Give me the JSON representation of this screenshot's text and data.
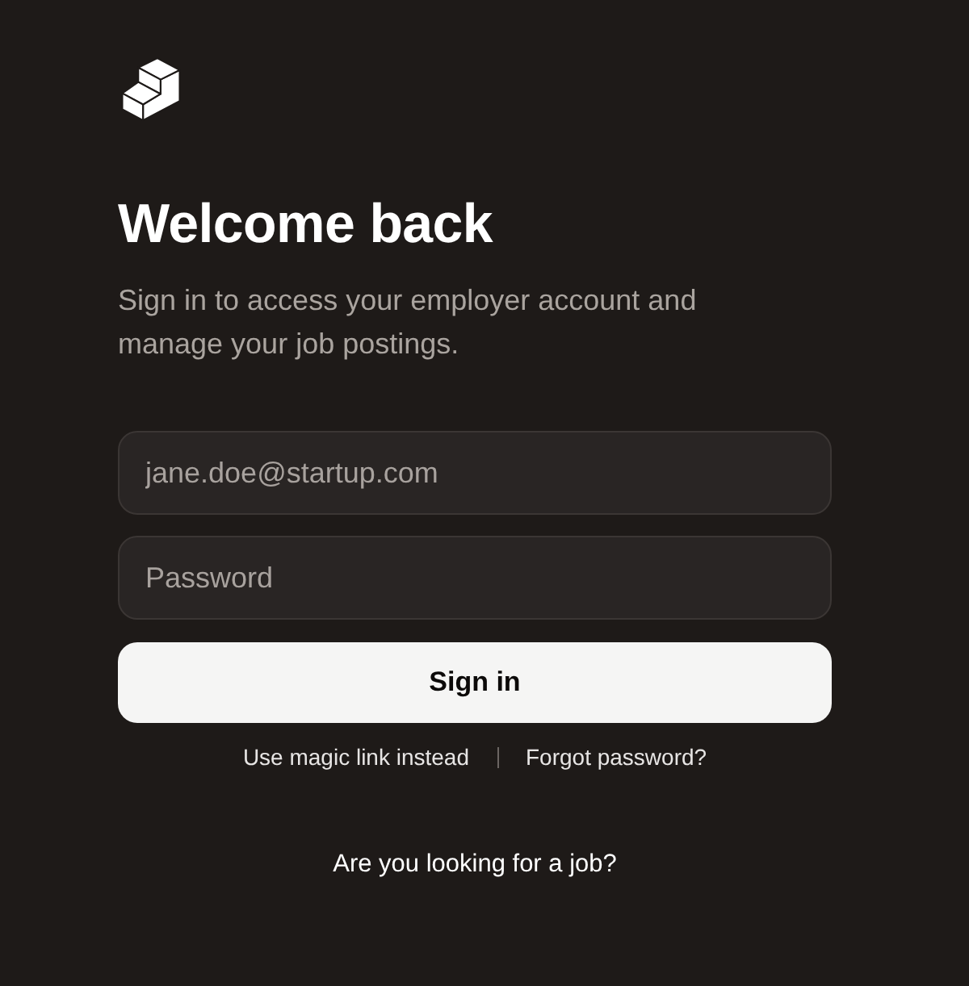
{
  "heading": "Welcome back",
  "subtitle": "Sign in to access your employer account and manage your job postings.",
  "fields": [
    {
      "placeholder": "jane.doe@startup.com"
    },
    {
      "placeholder": "Password"
    }
  ],
  "submit_button": "Sign in",
  "links": [
    "Use magic link instead",
    "Forgot password?"
  ],
  "footer_link": "Are you looking for a job?"
}
